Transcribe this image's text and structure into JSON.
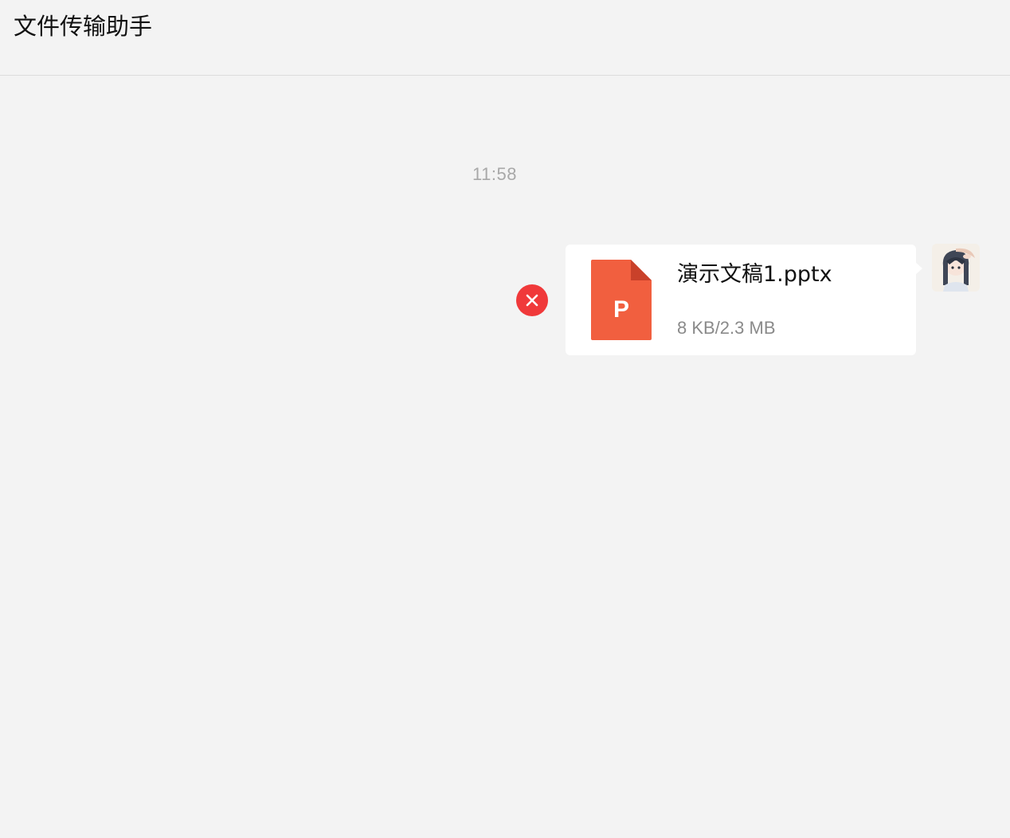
{
  "header": {
    "title": "文件传输助手"
  },
  "chat": {
    "timestamp": "11:58",
    "messages": [
      {
        "type": "file",
        "direction": "outgoing",
        "status": "failed",
        "status_icon": "error-x-icon",
        "file_icon": "pptx-file-icon",
        "file_icon_letter": "P",
        "file_name": "演示文稿1.pptx",
        "file_size": "8 KB/2.3 MB"
      }
    ]
  },
  "colors": {
    "background": "#f3f3f3",
    "bubble": "#ffffff",
    "error": "#f0393a",
    "pptx": "#f15f3f"
  }
}
